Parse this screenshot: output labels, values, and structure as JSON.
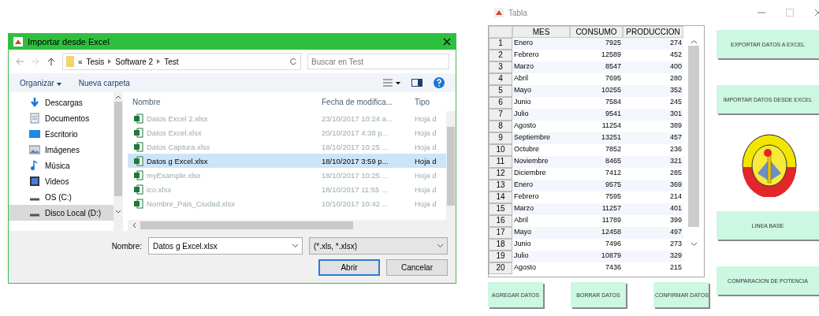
{
  "dialog": {
    "title": "Importar desde Excel",
    "breadcrumb": [
      "«",
      "Tesis",
      "Software 2",
      "Test"
    ],
    "search": {
      "placeholder": "Buscar en Test"
    },
    "toolbar": {
      "organize": "Organizar",
      "new_folder": "Nueva carpeta"
    },
    "nav_items": [
      {
        "label": "Descargas",
        "kind": "download",
        "selected": false
      },
      {
        "label": "Documentos",
        "kind": "document",
        "selected": false
      },
      {
        "label": "Escritorio",
        "kind": "desktop",
        "selected": false
      },
      {
        "label": "Imágenes",
        "kind": "image",
        "selected": false
      },
      {
        "label": "Música",
        "kind": "music",
        "selected": false
      },
      {
        "label": "Videos",
        "kind": "video",
        "selected": false
      },
      {
        "label": "OS (C:)",
        "kind": "drive",
        "selected": false
      },
      {
        "label": "Disco Local (D:)",
        "kind": "drive",
        "selected": true
      }
    ],
    "columns": [
      "Nombre",
      "Fecha de modifica...",
      "Tipo"
    ],
    "files": [
      {
        "name": "Datos Excel 2.xlsx",
        "date": "23/10/2017 10:24 a...",
        "type": "Hoja d",
        "selected": false
      },
      {
        "name": "Datos Excel.xlsx",
        "date": "20/10/2017 4:38 p...",
        "type": "Hoja d",
        "selected": false
      },
      {
        "name": "Datos Captura.xlsx",
        "date": "18/10/2017 10:25 ...",
        "type": "Hoja d",
        "selected": false
      },
      {
        "name": "Datos g Excel.xlsx",
        "date": "18/10/2017 3:59 p...",
        "type": "Hoja d",
        "selected": true
      },
      {
        "name": "myExample.xlsx",
        "date": "18/10/2017 10:25 ...",
        "type": "Hoja d",
        "selected": false
      },
      {
        "name": "ico.xlsx",
        "date": "18/10/2017 11:55 ...",
        "type": "Hoja d",
        "selected": false
      },
      {
        "name": "Nombre_Pais_Ciudad.xlsx",
        "date": "10/10/2017 10:42 ...",
        "type": "Hoja d",
        "selected": false
      }
    ],
    "filename_label": "Nombre:",
    "filename_value": "Datos g Excel.xlsx",
    "filter": "(*.xls, *.xlsx)",
    "buttons": [
      "Abrir",
      "Cancelar"
    ]
  },
  "table_window": {
    "title": "Tabla",
    "columns": [
      "",
      "MES",
      "CONSUMO",
      "PRODUCCION"
    ],
    "rows": [
      [
        "1",
        "Enero",
        "7925",
        "274"
      ],
      [
        "2",
        "Febrero",
        "12589",
        "452"
      ],
      [
        "3",
        "Marzo",
        "8547",
        "400"
      ],
      [
        "4",
        "Abril",
        "7695",
        "280"
      ],
      [
        "5",
        "Mayo",
        "10255",
        "352"
      ],
      [
        "6",
        "Junio",
        "7584",
        "245"
      ],
      [
        "7",
        "Julio",
        "9541",
        "301"
      ],
      [
        "8",
        "Agosto",
        "11254",
        "389"
      ],
      [
        "9",
        "Septiembre",
        "13251",
        "457"
      ],
      [
        "10",
        "Octubre",
        "7852",
        "236"
      ],
      [
        "11",
        "Noviembre",
        "8465",
        "321"
      ],
      [
        "12",
        "Diciembre",
        "7412",
        "285"
      ],
      [
        "13",
        "Enero",
        "9575",
        "369"
      ],
      [
        "14",
        "Febrero",
        "7595",
        "214"
      ],
      [
        "15",
        "Marzo",
        "11257",
        "401"
      ],
      [
        "16",
        "Abril",
        "11789",
        "399"
      ],
      [
        "17",
        "Mayo",
        "12458",
        "497"
      ],
      [
        "18",
        "Junio",
        "7496",
        "273"
      ],
      [
        "19",
        "Julio",
        "10879",
        "329"
      ],
      [
        "20",
        "Agosto",
        "7436",
        "215"
      ]
    ],
    "side_buttons": [
      "EXPORTAR DATOS A EXCEL",
      "IMPORTAR DATOS DESDE EXCEL",
      "LINEA BASE",
      "COMPARACION DE POTENCIA"
    ],
    "bottom_buttons": [
      "AGREGAR DATOS",
      "BORRAR DATOS",
      "CONFIRMAR DATOS"
    ]
  }
}
